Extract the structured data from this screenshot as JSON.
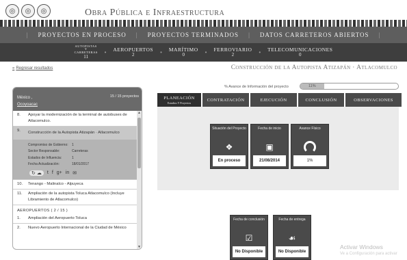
{
  "header": {
    "logos": [
      "◎",
      "◎",
      "◎"
    ],
    "title": "Obra Pública e Infraestructura"
  },
  "main_nav": {
    "items": [
      {
        "label": "Proyectos en proceso"
      },
      {
        "label": "Proyectos terminados"
      },
      {
        "label": "Datos carreteros abiertos"
      }
    ],
    "separator": "|"
  },
  "sub_nav": {
    "items": [
      {
        "label": "Autopistas y carreteras",
        "count": "11"
      },
      {
        "label": "Aeropuertos",
        "count": "2"
      },
      {
        "label": "Marítimo",
        "count": "0"
      },
      {
        "label": "Ferroviario",
        "count": "2"
      },
      {
        "label": "Telecomunicaciones",
        "count": "0"
      }
    ],
    "separator": "•"
  },
  "breadcrumb": {
    "arrow": "«",
    "back_label": "Regresar resultados"
  },
  "page_heading": "Construcción de la Autopista Atizapán · Atlacomulco",
  "progress": {
    "label": "% Avance de Información del proyecto",
    "value_text": "11%",
    "percent": 11
  },
  "sidebar": {
    "region": "México ,",
    "region_link": "Ocoyoacac",
    "total": "15 / 15 proyectos",
    "items": [
      {
        "num": "8.",
        "text": "Apoyar la modernización de la terminal de autobuses de Atlacomulco."
      },
      {
        "num": "9.",
        "text": "Construcción de la Autopista Atizapán · Atlacomulco"
      }
    ],
    "detail": {
      "rows": [
        {
          "k": "Compromiso de Gobierno:",
          "v": "1"
        },
        {
          "k": "Sector Responsable:",
          "v": "Carreteras"
        },
        {
          "k": "Estados de Influencia:",
          "v": "1"
        },
        {
          "k": "Fecha Actualización:",
          "v": "18/01/2017"
        }
      ],
      "share_icons": [
        "↻",
        "☁",
        "t",
        "f",
        "g+",
        "in",
        "✉"
      ]
    },
    "items_after": [
      {
        "num": "10.",
        "text": "Tenango - Malinalco - Alpuyeca"
      },
      {
        "num": "11.",
        "text": "Ampliación de la autopista Toluca Atlacomulco (Incluye Libramiento de Atlacomulco)"
      }
    ],
    "section": "AEROPUERTOS ( 2 / 15 )",
    "items_airports": [
      {
        "num": "1.",
        "text": "Ampliación del Aeropuerto Toluca"
      },
      {
        "num": "2.",
        "text": "Nuevo Aeropuerto Internacional de la Ciudad de México"
      }
    ],
    "scroll_up": "▲",
    "scroll_down": "▼"
  },
  "tabs": [
    {
      "label": "PLANEACIÓN",
      "sub": "Estudios Y Proyectos"
    },
    {
      "label": "CONTRATACIÓN",
      "sub": ""
    },
    {
      "label": "EJECUCIÓN",
      "sub": ""
    },
    {
      "label": "CONCLUSIÓN",
      "sub": ""
    },
    {
      "label": "OBSERVACIONES",
      "sub": ""
    }
  ],
  "cards_top": [
    {
      "title": "Situación del Proyecto",
      "icon": "❖",
      "value": "En proceso"
    },
    {
      "title": "Fecha de inicio",
      "icon": "▣",
      "value": "21/08/2014"
    },
    {
      "title": "Avance Físico",
      "icon": "gauge",
      "value": "1%"
    }
  ],
  "cards_bottom": [
    {
      "title": "Fecha de conclusión",
      "icon": "☑",
      "value": "No Disponible"
    },
    {
      "title": "Fecha de entrega",
      "icon": "☙",
      "value": "No Disponible"
    }
  ],
  "watermark": {
    "line1": "Activar Windows",
    "line2": "Ve a Configuración para activar"
  }
}
